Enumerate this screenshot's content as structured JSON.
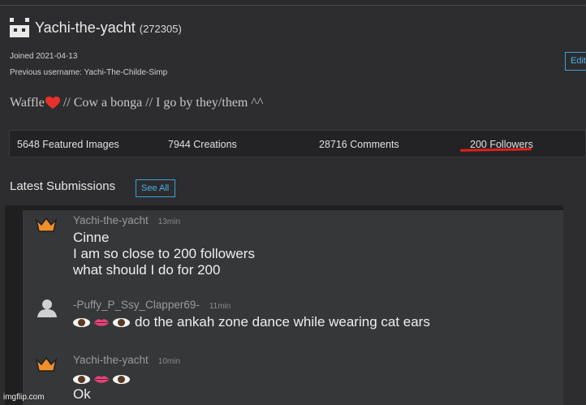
{
  "profile": {
    "username": "Yachi-the-yacht",
    "user_id": "(272305)",
    "joined": "Joined 2021-04-13",
    "previous_username": "Previous username: Yachi-The-Childe-Simp",
    "edit_label": "Edit",
    "bio_prefix": "Waffle",
    "bio_suffix": " // Cow a bonga // I go by they/them ^^"
  },
  "stats": {
    "featured": "5648 Featured Images",
    "creations": "7944 Creations",
    "comments": "28716 Comments",
    "followers": "200 Followers"
  },
  "latest": {
    "title": "Latest Submissions",
    "see_all": "See All"
  },
  "chat": {
    "messages": [
      {
        "author": "Yachi-the-yacht",
        "time": "13min",
        "icon": "crown-icon",
        "lines": [
          "Cinne",
          "I am so close to 200 followers",
          "what should I do for 200"
        ]
      },
      {
        "author": "-Puffy_P_Ssy_Clapper69-",
        "time": "11min",
        "icon": "user-silhouette-icon",
        "lines": [
          "do the ankah zone dance while wearing cat ears"
        ]
      },
      {
        "author": "Yachi-the-yacht",
        "time": "10min",
        "icon": "crown-icon",
        "lines": [
          "",
          "Ok"
        ]
      }
    ]
  },
  "watermark": "imgflip.com",
  "colors": {
    "accent": "#3aa0d8",
    "underline": "#e0201a",
    "crown": "#f0902a"
  }
}
